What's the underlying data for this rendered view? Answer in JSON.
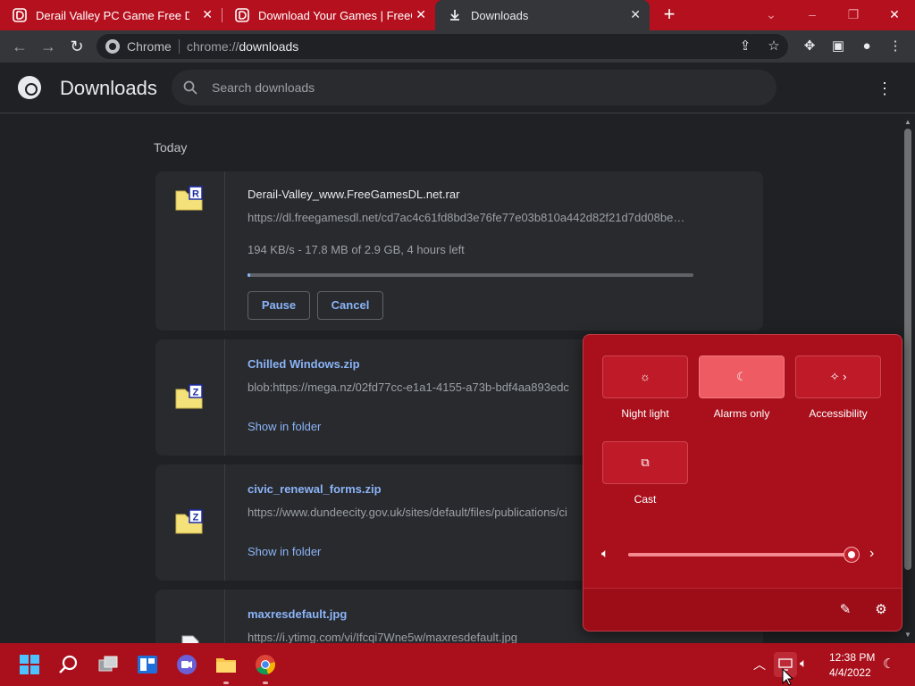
{
  "tabs": [
    {
      "title": "Derail Valley PC Game Free Dow"
    },
    {
      "title": "Download Your Games | FreeGam"
    },
    {
      "title": "Downloads"
    }
  ],
  "omnibox": {
    "site": "Chrome",
    "url_prefix": "chrome://",
    "url_host": "downloads"
  },
  "header": {
    "title": "Downloads",
    "search_placeholder": "Search downloads"
  },
  "list": {
    "group_label": "Today",
    "items": [
      {
        "name": "Derail-Valley_www.FreeGamesDL.net.rar",
        "url": "https://dl.freegamesdl.net/cd7ac4c61fd8bd3e76fe77e03b810a442d82f21d7dd08be…",
        "status": "194 KB/s - 17.8 MB of 2.9 GB, 4 hours left",
        "progress": 0.006,
        "pause_label": "Pause",
        "cancel_label": "Cancel",
        "icon_letter": "R"
      },
      {
        "name": "Chilled Windows.zip",
        "url": "blob:https://mega.nz/02fd77cc-e1a1-4155-a73b-bdf4aa893edc",
        "action": "Show in folder",
        "icon_letter": "Z"
      },
      {
        "name": "civic_renewal_forms.zip",
        "url": "https://www.dundeecity.gov.uk/sites/default/files/publications/ci",
        "action": "Show in folder",
        "icon_letter": "Z"
      },
      {
        "name": "maxresdefault.jpg",
        "url": "https://i.ytimg.com/vi/Ifcqi7Wne5w/maxresdefault.jpg"
      }
    ]
  },
  "quick_settings": {
    "tiles": [
      {
        "label": "Night light",
        "icon": "brightness-icon",
        "on": false
      },
      {
        "label": "Alarms only",
        "icon": "moon-icon",
        "on": true
      },
      {
        "label": "Accessibility",
        "icon": "accessibility-icon",
        "on": false
      },
      {
        "label": "Cast",
        "icon": "cast-icon",
        "on": false
      }
    ],
    "volume": 1.0
  },
  "taskbar": {
    "time": "12:38 PM",
    "date": "4/4/2022"
  },
  "colors": {
    "accent": "#a9101c",
    "tab_red": "#b5101e",
    "link": "#8ab4f8"
  }
}
